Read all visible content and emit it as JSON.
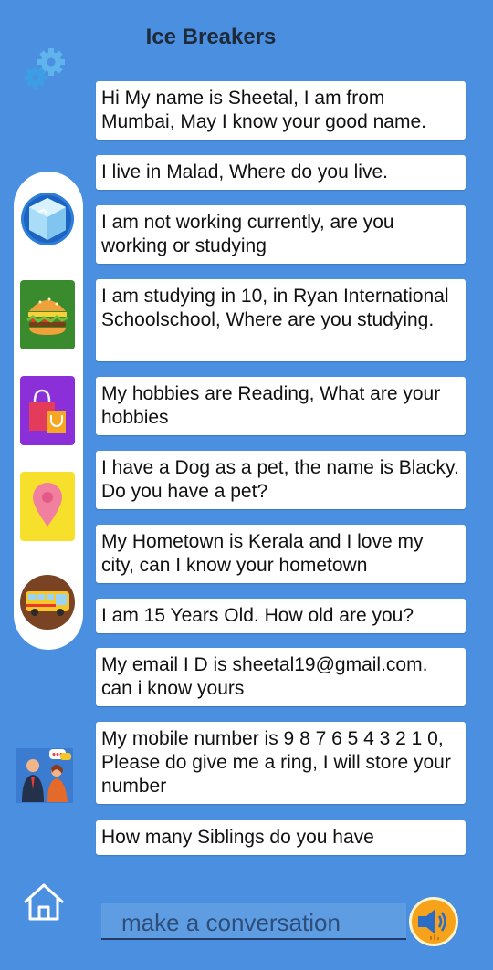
{
  "header": {
    "title": "Ice Breakers"
  },
  "categories": [
    {
      "name": "ice"
    },
    {
      "name": "burger"
    },
    {
      "name": "shopping"
    },
    {
      "name": "location"
    },
    {
      "name": "bus"
    }
  ],
  "messages": [
    "Hi My name is Sheetal, I am from Mumbai, May I know your good name.",
    "I live in Malad, Where do you live.",
    "I am not working currently, are you working or studying",
    "I am studying in 10, in Ryan International Schoolschool,  Where are you studying.",
    "My hobbies are Reading, What are your hobbies",
    "I have a  Dog as a pet, the name is Blacky. Do you have a pet?",
    "My Hometown is Kerala  and I love my city, can I know your hometown",
    "I am  15  Years Old. How old are you?",
    "My email I D is  sheetal19@gmail.com. can i know yours",
    "My mobile number is   9 8 7 6 5 4 3 2 1 0,  Please do give me a ring, I will store your number",
    "How many Siblings do you have"
  ],
  "input": {
    "placeholder": "make a conversation"
  }
}
